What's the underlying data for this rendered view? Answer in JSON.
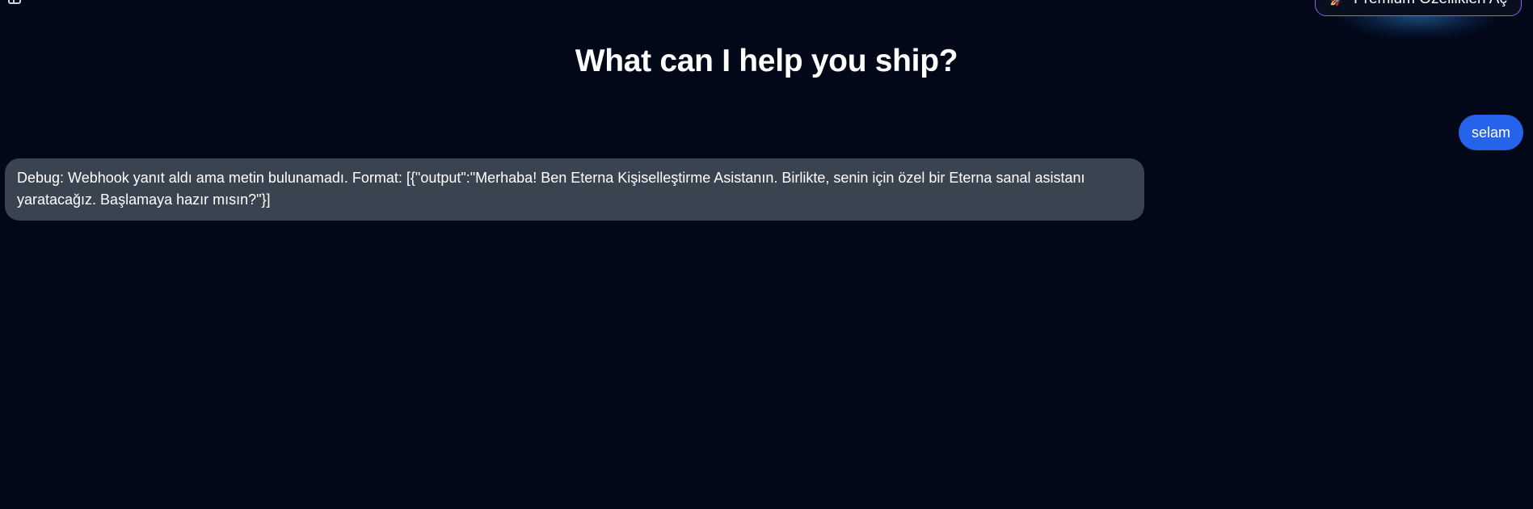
{
  "header": {
    "sidebar_toggle_icon": "sidebar-panel-icon",
    "premium_button": {
      "icon": "rocket-icon",
      "label": "Premium Özellikleri Aç"
    }
  },
  "main": {
    "title": "What can I help you ship?"
  },
  "chat": {
    "messages": [
      {
        "role": "user",
        "text": "selam"
      },
      {
        "role": "assistant",
        "text": "Debug: Webhook yanıt aldı ama metin bulunamadı. Format: [{\"output\":\"Merhaba! Ben Eterna Kişiselleştirme Asistanın. Birlikte, senin için özel bir Eterna sanal asistanı yaratacağız. Başlamaya hazır mısın?\"}]"
      }
    ]
  },
  "colors": {
    "background": "#020818",
    "user_bubble": "#2563eb",
    "assistant_bubble": "#3a4350",
    "premium_border": "#7c6cf0"
  }
}
